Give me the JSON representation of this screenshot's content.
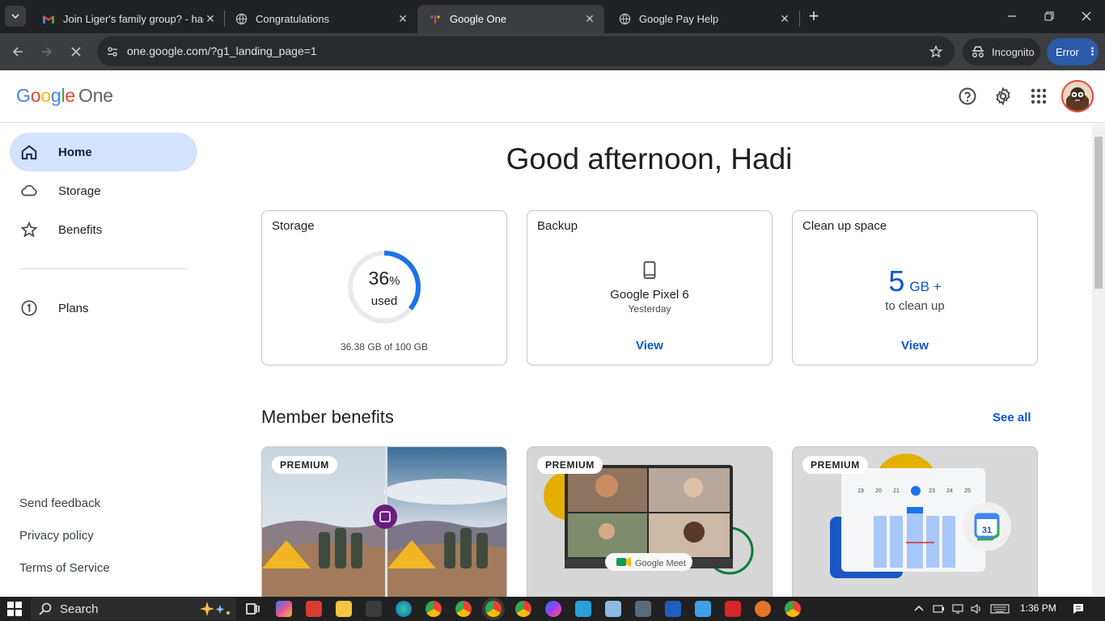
{
  "browser": {
    "tabs": [
      {
        "title": "Join Liger's family group? - hadi",
        "favicon": "gmail-icon"
      },
      {
        "title": "Congratulations",
        "favicon": "globe-icon"
      },
      {
        "title": "Google One",
        "favicon": "google-one-icon",
        "active": true
      },
      {
        "title": "Google Pay Help",
        "favicon": "globe-icon"
      }
    ],
    "url": "one.google.com/?g1_landing_page=1",
    "incognito_label": "Incognito",
    "error_label": "Error"
  },
  "header": {
    "logo_google": "Google",
    "logo_one": "One"
  },
  "nav": {
    "items": [
      {
        "label": "Home",
        "icon": "home-icon",
        "active": true
      },
      {
        "label": "Storage",
        "icon": "cloud-icon"
      },
      {
        "label": "Benefits",
        "icon": "star-icon"
      },
      {
        "label": "Plans",
        "icon": "plan-one-icon"
      }
    ],
    "footer": [
      "Send feedback",
      "Privacy policy",
      "Terms of Service"
    ]
  },
  "main": {
    "greeting": "Good afternoon, Hadi",
    "storage": {
      "title": "Storage",
      "percent": "36",
      "percent_sign": "%",
      "used_label": "used",
      "fraction_used": 0.36,
      "caption": "36.38 GB of 100 GB"
    },
    "backup": {
      "title": "Backup",
      "device": "Google Pixel 6",
      "when": "Yesterday",
      "link": "View"
    },
    "cleanup": {
      "title": "Clean up space",
      "amount": "5",
      "unit": "GB +",
      "sub": "to clean up",
      "link": "View"
    },
    "benefits": {
      "title": "Member benefits",
      "see_all": "See all",
      "badge": "PREMIUM",
      "meet_label": "Google Meet",
      "calendar_day": "31",
      "calendar_dates": [
        "19",
        "20",
        "21",
        "22",
        "23",
        "24",
        "25"
      ]
    }
  },
  "taskbar": {
    "search_label": "Search",
    "time": "1:36 PM"
  },
  "colors": {
    "accent": "#0b57d0",
    "nav_active": "#d3e3fd",
    "donut": "#1a73e8",
    "chrome_dark": "#202124"
  }
}
